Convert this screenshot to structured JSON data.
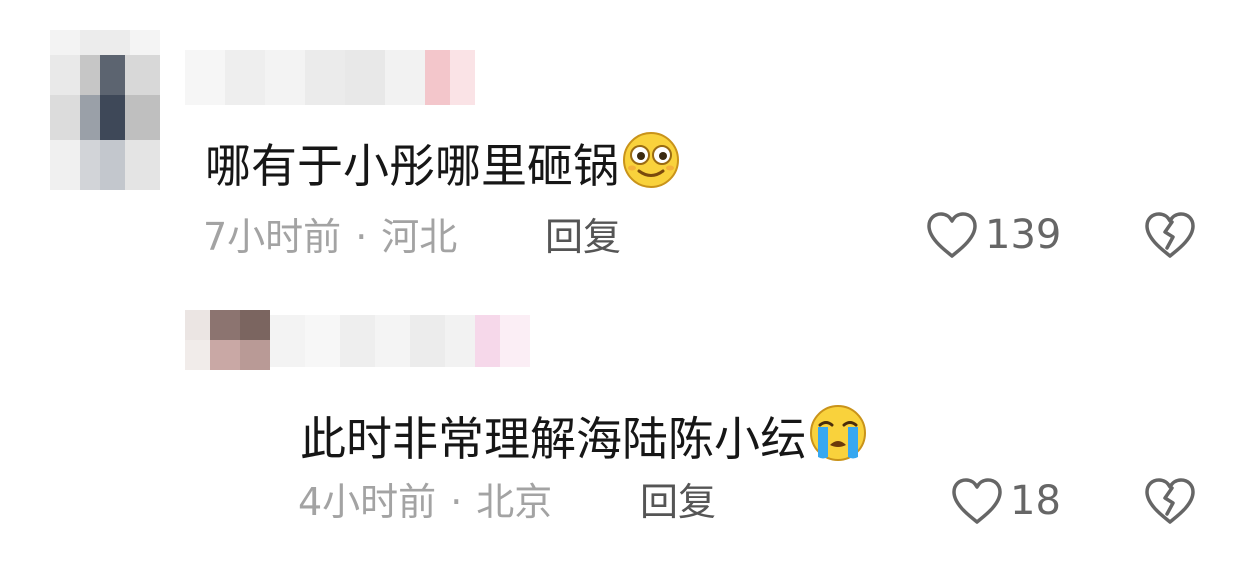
{
  "comments": [
    {
      "text": "哪有于小彤哪里砸锅",
      "emoji": "flushed-smile-emoji",
      "time": "7小时前",
      "separator": "·",
      "location": "河北",
      "reply_label": "回复",
      "like_count": "139"
    },
    {
      "text": "此时非常理解海陆陈小纭",
      "emoji": "crying-emoji",
      "time": "4小时前",
      "separator": "·",
      "location": "北京",
      "reply_label": "回复",
      "like_count": "18"
    }
  ],
  "colors": {
    "text": "#161616",
    "meta": "#a3a3a3",
    "reply": "#555555",
    "count": "#666666",
    "icon": "#666666",
    "emoji_yellow": "#f9d23c",
    "tear_blue": "#37a8f0"
  }
}
